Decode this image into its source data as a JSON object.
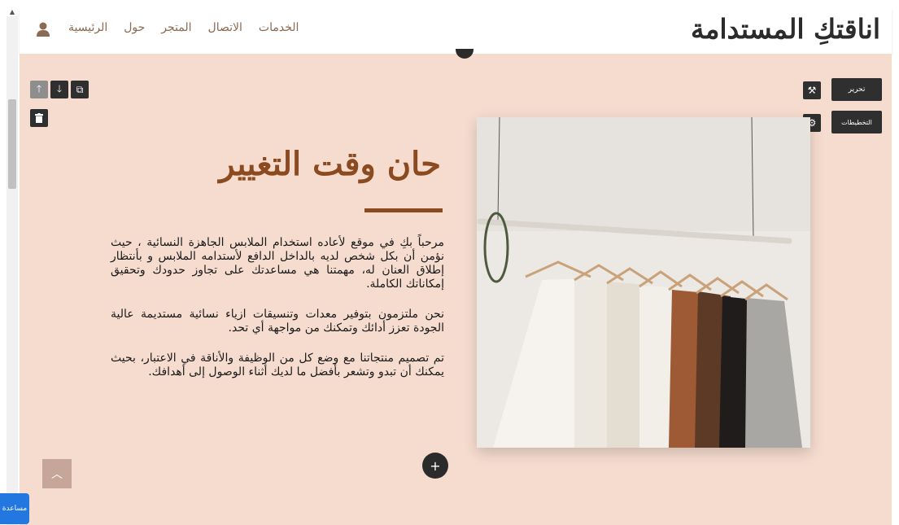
{
  "brand": {
    "title": "اناقتكِ المستدامة"
  },
  "nav": {
    "items": [
      "الرئيسية",
      "حول",
      "المتجر",
      "الاتصال",
      "الخدمات"
    ]
  },
  "editor": {
    "edit_label": "تحرير",
    "layouts_label": "التخطيطات"
  },
  "hero": {
    "heading": "حان وقت التغيير",
    "paragraphs": [
      "مرحباً بكِ في موقع لأعاده استخدام الملابس الجاهزة النسائية ، حيث نؤمن أن بكل شخص لديه بالداخل الدافع لأستدامه الملابس و بأنتظار إطلاق العنان له، مهمتنا هي مساعدتك على تجاوز حدودك وتحقيق إمكاناتك الكاملة.",
      "نحن ملتزمون بتوفير معدات وتنسيقات ازياء نسائية مستديمة عالية الجودة تعزز أدائك وتمكنك من مواجهة أي تحد.",
      "تم تصميم منتجاتنا مع وضع كل من الوظيفة والأناقة في الاعتبار، بحيث يمكنك أن تبدو وتشعر بأفضل ما لديك أثناء الوصول إلى أهدافك."
    ]
  },
  "help": {
    "label": "مساعدة"
  },
  "icons": {
    "user": "user-icon",
    "up": "arrow-up-icon",
    "down": "arrow-down-icon",
    "copy": "copy-icon",
    "delete": "trash-icon",
    "magic": "magic-wand-icon",
    "gear": "gear-icon",
    "chevron": "chevron-up-icon",
    "plus": "plus-icon"
  },
  "colors": {
    "page_bg": "#f6dccf",
    "accent": "#8b4a1f",
    "nav_link": "#8a6a52",
    "help_blue": "#2277e0"
  }
}
